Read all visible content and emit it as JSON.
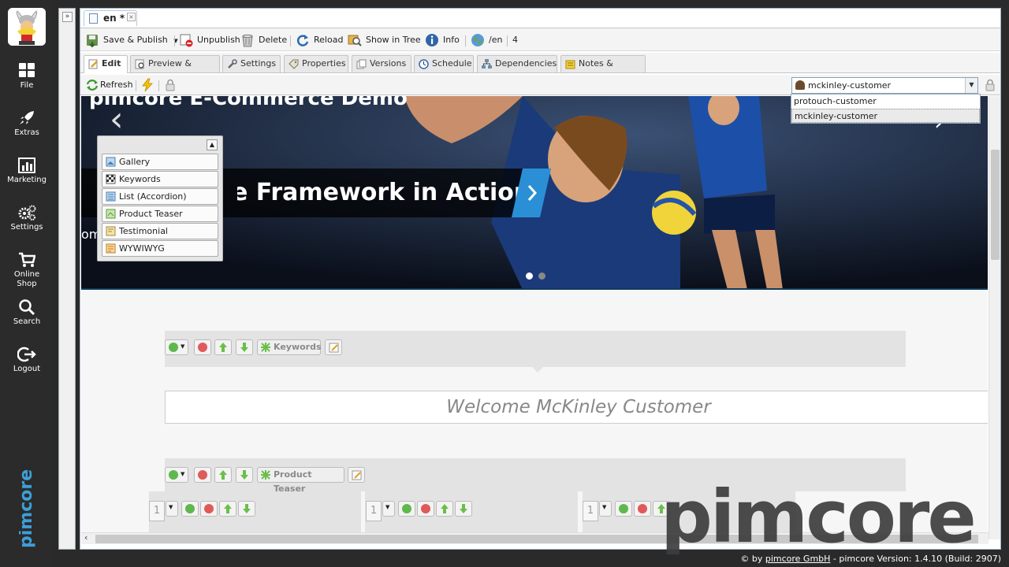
{
  "nav": {
    "items": [
      {
        "label": "File",
        "icon": "grid-icon"
      },
      {
        "label": "Extras",
        "icon": "rocket-icon"
      },
      {
        "label": "Marketing",
        "icon": "chart-icon"
      },
      {
        "label": "Settings",
        "icon": "gears-icon"
      },
      {
        "label": "Online\nShop",
        "icon": "cart-icon"
      },
      {
        "label": "Search",
        "icon": "search-icon"
      },
      {
        "label": "Logout",
        "icon": "logout-icon"
      }
    ],
    "brand": "pimcore"
  },
  "document_tab": {
    "label": "en *"
  },
  "toolbar": {
    "save_publish": "Save & Publish",
    "unpublish": "Unpublish",
    "delete": "Delete",
    "reload": "Reload",
    "show_in_tree": "Show in Tree",
    "info": "Info",
    "path": "/en",
    "id": "4"
  },
  "tabs": [
    "Edit",
    "Preview & Styles",
    "Settings",
    "Properties",
    "Versions",
    "Schedule",
    "Dependencies",
    "Notes & Events"
  ],
  "edit_toolbar": {
    "refresh": "Refresh"
  },
  "persona": {
    "selected": "mckinley-customer",
    "options": [
      "protouch-customer",
      "mckinley-customer"
    ]
  },
  "hero": {
    "title": "pimcore E-Commerce Demo",
    "banner": "E-Commerce Framework in Action",
    "subtitle": "om",
    "active_slide": 1,
    "slides": 2
  },
  "blocks": [
    "Gallery",
    "Keywords",
    "List (Accordion)",
    "Product Teaser",
    "Testimonial",
    "WYWIWYG"
  ],
  "areas": {
    "keywords_label": "Keywords",
    "welcome_text": "Welcome McKinley Customer",
    "teaser_label": "Product Teaser",
    "column_value": "1"
  },
  "watermark": "pimcore",
  "footer": {
    "prefix": "© by",
    "company": "pimcore GmbH",
    "version": "- pimcore Version: 1.4.10 (Build: 2907)"
  },
  "colors": {
    "accent_blue": "#2b8fd6",
    "nav_bg": "#2b2b2b",
    "panel_border": "#9fb3c8"
  }
}
